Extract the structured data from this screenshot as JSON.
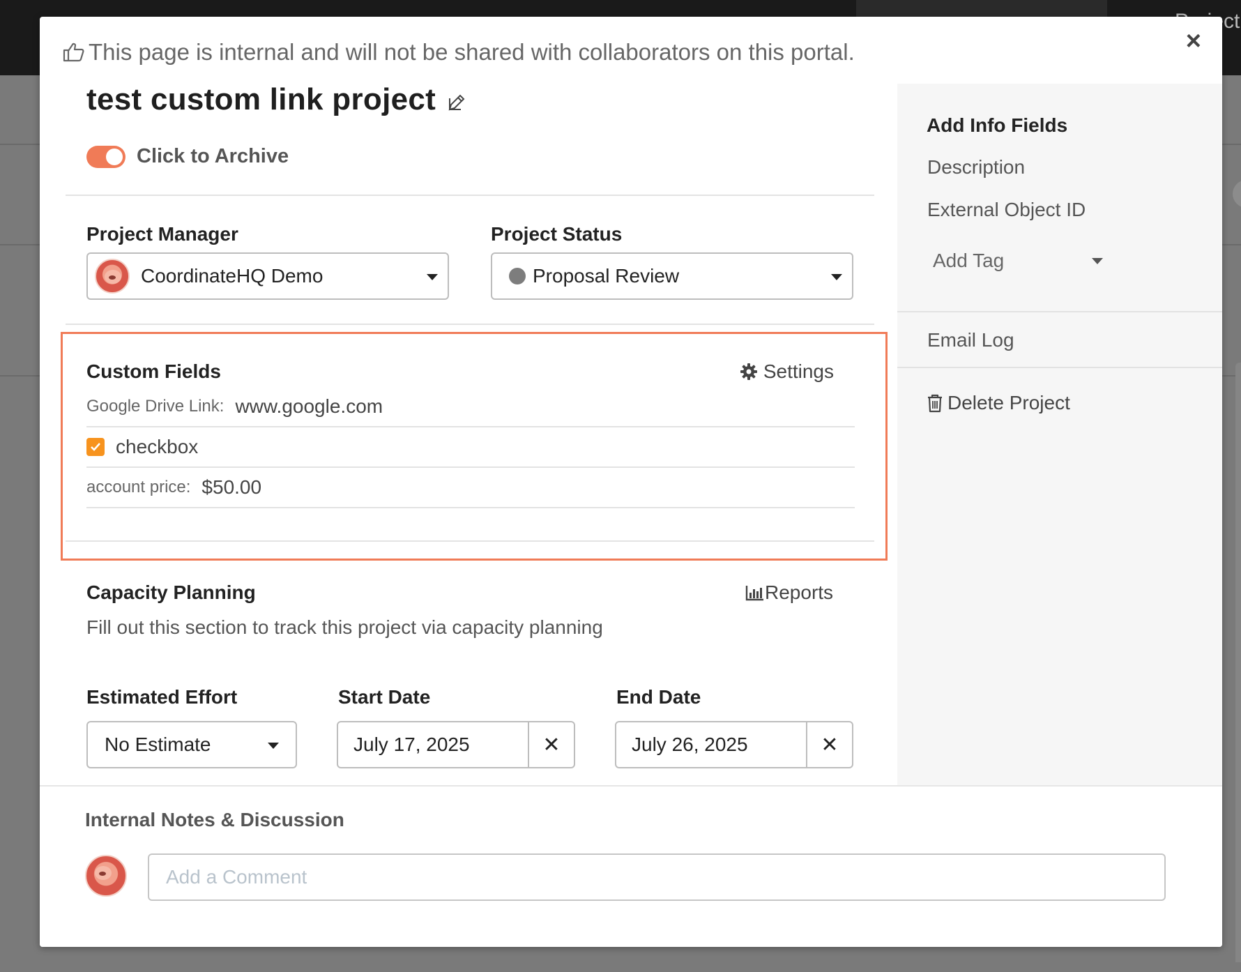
{
  "background": {
    "topbar_text": "Project"
  },
  "notice": {
    "text": "This page is internal and will not be shared with collaborators on this portal.",
    "icon": "thumbs-up-icon"
  },
  "close": {
    "label": "×"
  },
  "project": {
    "title": "test custom link project",
    "archive_label": "Click to Archive",
    "archived_toggle_on": true
  },
  "project_manager": {
    "label": "Project Manager",
    "value": "CoordinateHQ Demo"
  },
  "project_status": {
    "label": "Project Status",
    "value": "Proposal Review",
    "dot_color": "#7d7d7d"
  },
  "custom_fields": {
    "title": "Custom Fields",
    "settings_label": "Settings",
    "rows": [
      {
        "key": "Google Drive Link:",
        "value": "www.google.com"
      },
      {
        "type": "checkbox",
        "value": "checkbox",
        "checked": true
      },
      {
        "key": "account price:",
        "value": "$50.00"
      }
    ]
  },
  "capacity_planning": {
    "title": "Capacity Planning",
    "reports_label": "Reports",
    "description": "Fill out this section to track this project via capacity planning",
    "estimated_effort": {
      "label": "Estimated Effort",
      "value": "No Estimate"
    },
    "start_date": {
      "label": "Start Date",
      "value": "July 17, 2025"
    },
    "end_date": {
      "label": "End Date",
      "value": "July 26, 2025"
    },
    "clear_label": "✕"
  },
  "sidebar": {
    "title": "Add Info Fields",
    "items": [
      "Description",
      "External Object ID"
    ],
    "add_tag_label": "Add Tag",
    "email_log_label": "Email Log",
    "delete_label": "Delete Project"
  },
  "notes": {
    "title": "Internal Notes & Discussion",
    "comment_placeholder": "Add a Comment"
  },
  "colors": {
    "accent": "#f07b57",
    "checkbox": "#f7931e"
  }
}
